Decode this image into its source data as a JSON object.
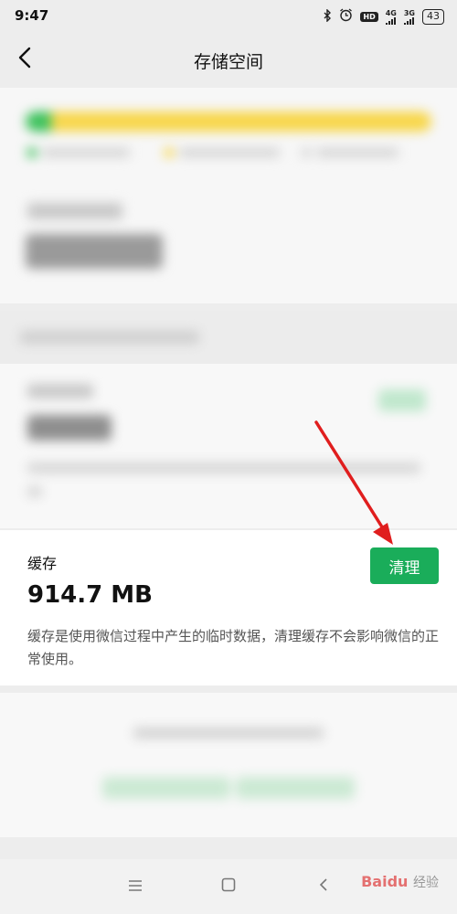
{
  "status_bar": {
    "time": "9:47",
    "network_4g": "4G",
    "network_3g": "3G",
    "hd_badge": "HD",
    "battery": "43",
    "icons": [
      "bluetooth-icon",
      "alarm-icon",
      "hd-icon",
      "signal-4g-icon",
      "signal-3g-icon",
      "battery-icon"
    ]
  },
  "nav": {
    "title": "存储空间",
    "back_icon": "back-chevron-icon"
  },
  "colors": {
    "accent_green": "#1aad5a",
    "usage_yellow": "#f7d64a",
    "usage_green": "#3cc15c",
    "annotation_red": "#e01e1e"
  },
  "cache": {
    "title": "缓存",
    "size": "914.7 MB",
    "description": "缓存是使用微信过程中产生的临时数据，清理缓存不会影响微信的正常使用。",
    "clean_button": "清理"
  },
  "system_nav": {
    "icons": [
      "menu-icon",
      "home-icon",
      "back-icon"
    ]
  },
  "watermark": {
    "brand": "Baidu",
    "suffix": "经验"
  }
}
